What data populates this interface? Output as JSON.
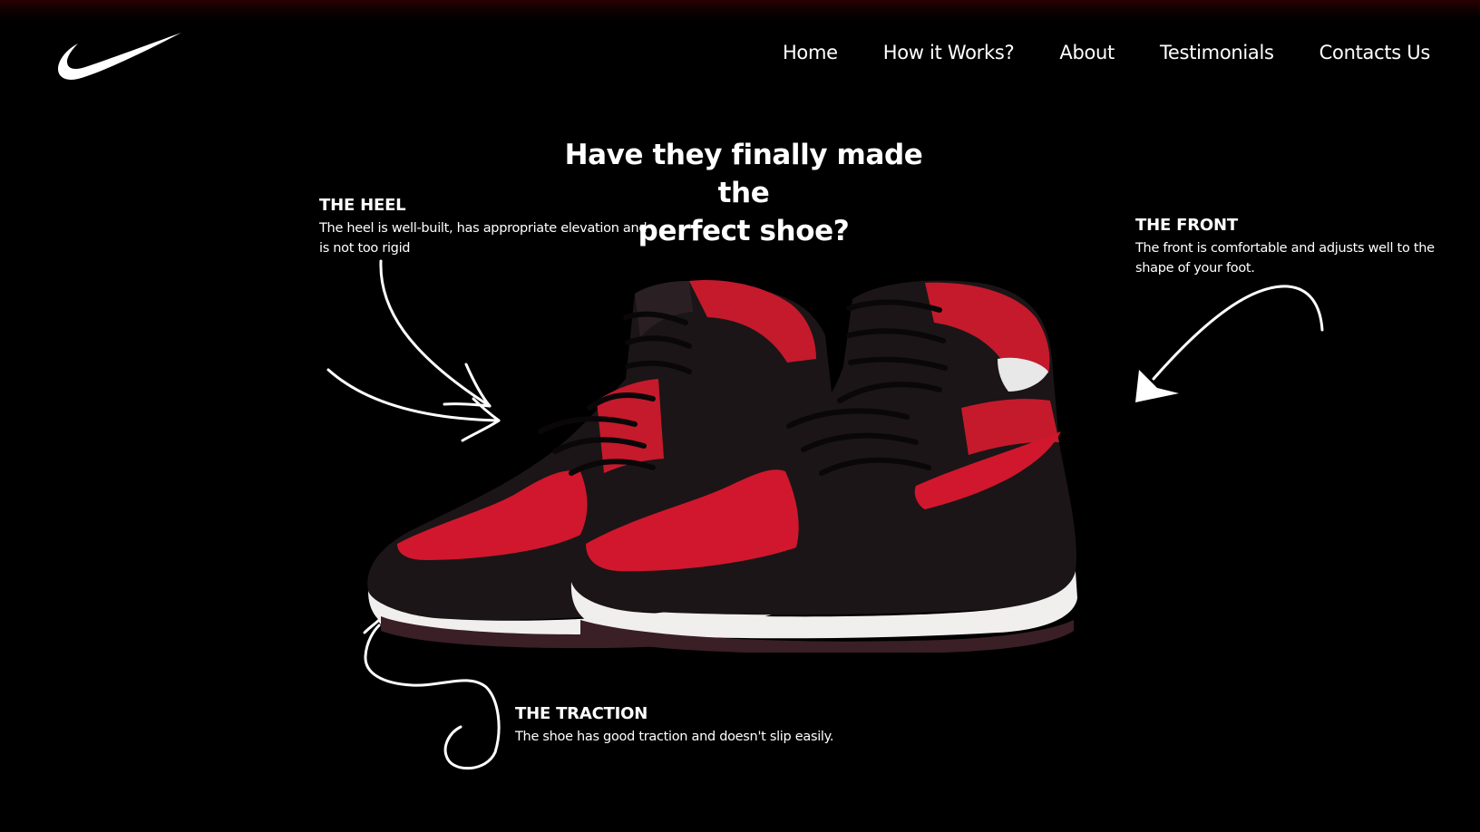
{
  "brand": {
    "logo": "nike-swoosh-icon"
  },
  "nav": {
    "items": [
      {
        "label": "Home"
      },
      {
        "label": "How it Works?"
      },
      {
        "label": "About"
      },
      {
        "label": "Testimonials"
      },
      {
        "label": "Contacts Us"
      }
    ]
  },
  "hero": {
    "headline_line1": "Have they finally made the",
    "headline_line2": "perfect shoe?",
    "image": "air-jordan-1-mid-sneakers-image"
  },
  "features": {
    "heel": {
      "title": "THE HEEL",
      "text": "The heel is well-built, has appropriate elevation and is not too rigid"
    },
    "front": {
      "title": "THE FRONT",
      "text": "The front is comfortable and adjusts well to the shape of your foot."
    },
    "traction": {
      "title": "THE TRACTION",
      "text": "The shoe has good traction and doesn't slip easily."
    }
  },
  "colors": {
    "background": "#000000",
    "text": "#ffffff",
    "accent_red": "#d1172d",
    "shoe_black": "#1b1517",
    "sole_white": "#f1eeee"
  }
}
